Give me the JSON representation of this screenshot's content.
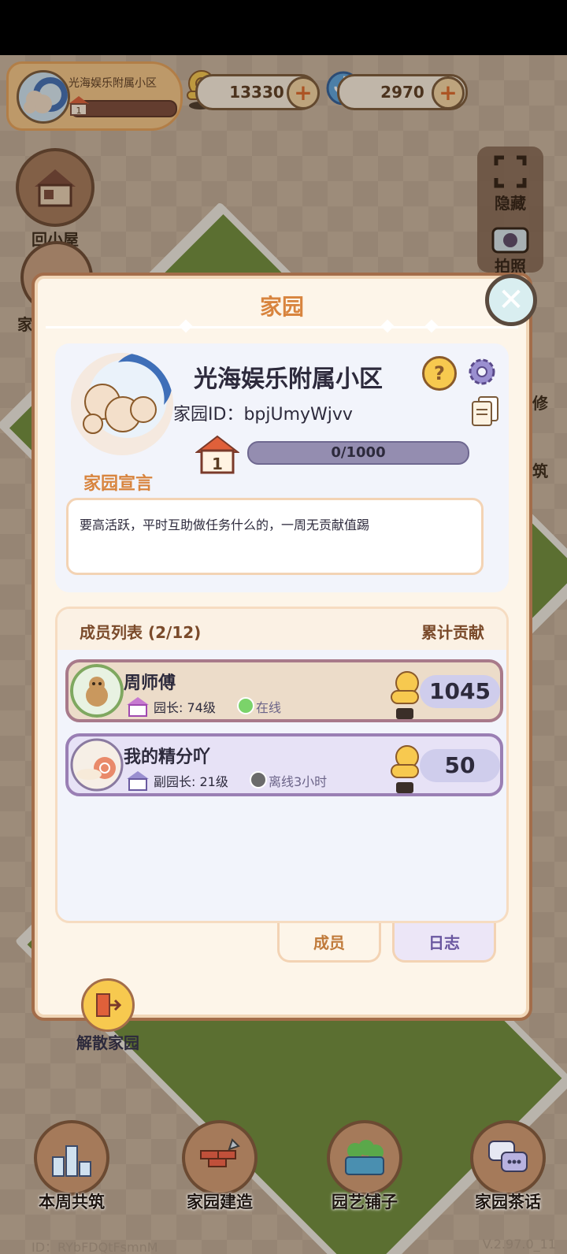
{
  "hud": {
    "community_name": "光海娱乐附属小区",
    "community_level": "1",
    "gold": "13330",
    "gems": "2970"
  },
  "side": {
    "home_label": "回小屋",
    "home_left_clip": "家",
    "hide_label": "隐藏",
    "photo_label": "拍照",
    "repair_clip": "修",
    "build_clip": "筑"
  },
  "modal": {
    "title": "家园",
    "name": "光海娱乐附属小区",
    "id_label": "家园ID：",
    "id_value": "bpjUmyWjvv",
    "level": "1",
    "progress": "0/1000",
    "progress_fraction": 0,
    "declaration_label": "家园宣言",
    "declaration": "要高活跃，平时互助做任务什么的，一周无贡献值踢",
    "members_title": "成员列表 (2/12)",
    "contrib_title": "累计贡献",
    "members": [
      {
        "name": "周师傅",
        "role": "园长: 74级",
        "status": "在线",
        "status_color": "#7bd36a",
        "score": "1045"
      },
      {
        "name": "我的精分吖",
        "role": "副园长: 21级",
        "status": "离线3小时",
        "status_color": "#6b6b6b",
        "score": "50"
      }
    ],
    "tab_members": "成员",
    "tab_log": "日志",
    "dissolve": "解散家园"
  },
  "bottom": {
    "items": [
      "本周共筑",
      "家园建造",
      "园艺铺子",
      "家园茶话"
    ],
    "id_text": "ID：RYbFDQtFsmnM",
    "version": "V.2.97.0_11"
  },
  "colors": {
    "accent": "#d8843e",
    "modal_border": "#a36d4a"
  }
}
